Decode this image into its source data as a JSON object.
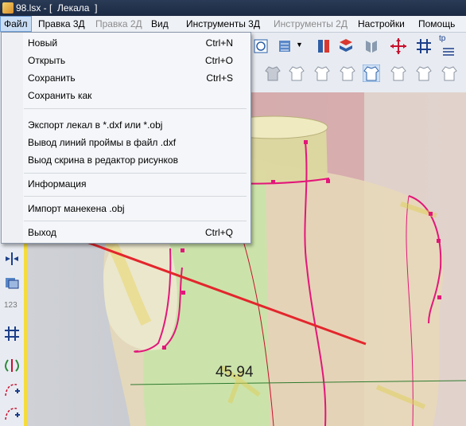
{
  "window": {
    "title": "98.lsx - [  Лекала  ]"
  },
  "menubar": [
    {
      "label": "Файл",
      "state": "active"
    },
    {
      "label": "Правка 3Д",
      "state": "normal"
    },
    {
      "label": "Правка 2Д",
      "state": "disabled"
    },
    {
      "label": "Вид",
      "state": "normal"
    },
    {
      "label": "Инструменты 3Д",
      "state": "normal"
    },
    {
      "label": "Инструменты 2Д",
      "state": "disabled"
    },
    {
      "label": "Настройки",
      "state": "normal"
    },
    {
      "label": "Помощь",
      "state": "normal"
    }
  ],
  "file_menu": {
    "items": [
      {
        "label": "Новый",
        "shortcut": "Ctrl+N"
      },
      {
        "label": "Открыть",
        "shortcut": "Ctrl+O"
      },
      {
        "label": "Сохранить",
        "shortcut": "Ctrl+S"
      },
      {
        "label": "Сохранить как",
        "shortcut": ""
      },
      {
        "label": "Экспорт лекал в *.dxf или *.obj",
        "shortcut": ""
      },
      {
        "label": "Вывод линий проймы в файл .dxf",
        "shortcut": ""
      },
      {
        "label": "Выод скрина в редактор рисунков",
        "shortcut": ""
      },
      {
        "label": "Информация",
        "shortcut": ""
      },
      {
        "label": "Импорт манекена .obj",
        "shortcut": ""
      },
      {
        "label": "Выход",
        "shortcut": "Ctrl+Q"
      }
    ]
  },
  "viewport": {
    "measurement": "45.94",
    "annotation_color": "#e3262c",
    "curve_color": "#e3167a"
  },
  "toolbar": {
    "tp_label": "tp"
  },
  "left_toolbar": {
    "ruler_label": "123"
  }
}
